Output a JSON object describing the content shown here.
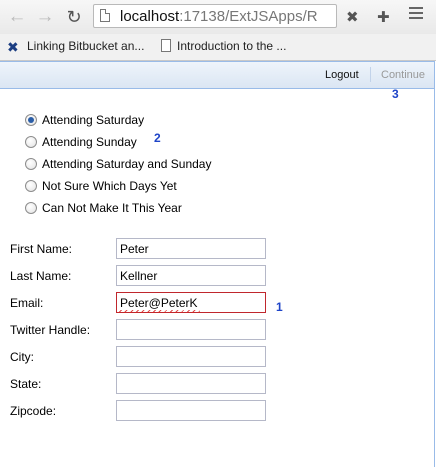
{
  "browser": {
    "url_host": "localhost",
    "url_rest": ":17138/ExtJSApps/R",
    "bookmarks": [
      {
        "label": "Linking Bitbucket an..."
      },
      {
        "label": "Introduction to the ..."
      }
    ]
  },
  "header": {
    "logout_label": "Logout",
    "continue_label": "Continue"
  },
  "annotations": {
    "email_marker": "1",
    "radio_marker": "2",
    "continue_marker": "3"
  },
  "attendance": {
    "options": [
      {
        "label": "Attending Saturday",
        "checked": true
      },
      {
        "label": "Attending Sunday",
        "checked": false
      },
      {
        "label": "Attending Saturday and Sunday",
        "checked": false
      },
      {
        "label": "Not Sure Which Days Yet",
        "checked": false
      },
      {
        "label": "Can Not Make It This Year",
        "checked": false
      }
    ]
  },
  "form": {
    "fields": [
      {
        "label": "First Name:",
        "value": "Peter"
      },
      {
        "label": "Last Name:",
        "value": "Kellner"
      },
      {
        "label": "Email:",
        "value": "Peter@PeterK"
      },
      {
        "label": "Twitter Handle:",
        "value": ""
      },
      {
        "label": "City:",
        "value": ""
      },
      {
        "label": "State:",
        "value": ""
      },
      {
        "label": "Zipcode:",
        "value": ""
      }
    ]
  },
  "colors": {
    "accent": "#1e44c8",
    "header_border": "#99bbe8",
    "invalid_border": "#c0272d"
  },
  "icons": [
    "back-icon",
    "forward-icon",
    "reload-icon",
    "page-icon",
    "extension-icon",
    "menu-icon",
    "bitbucket-icon",
    "document-icon"
  ]
}
